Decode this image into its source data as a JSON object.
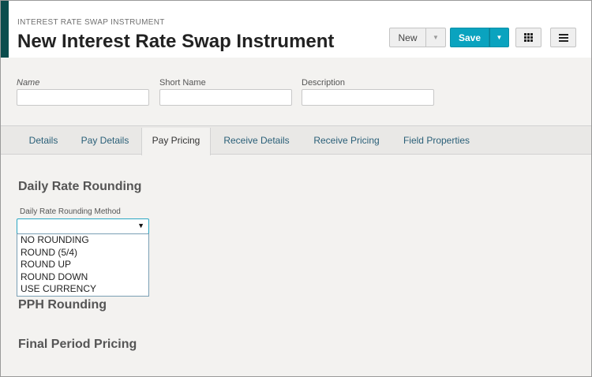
{
  "header": {
    "breadcrumb": "INTEREST RATE SWAP INSTRUMENT",
    "title": "New Interest Rate Swap Instrument",
    "new_label": "New",
    "save_label": "Save",
    "accent_color": "#0b4d4d",
    "save_color": "#0aa3bf"
  },
  "fields": {
    "name_label": "Name",
    "name_value": "",
    "short_name_label": "Short Name",
    "short_name_value": "",
    "description_label": "Description",
    "description_value": ""
  },
  "tabs": [
    {
      "label": "Details"
    },
    {
      "label": "Pay Details"
    },
    {
      "label": "Pay Pricing",
      "active": true
    },
    {
      "label": "Receive Details"
    },
    {
      "label": "Receive Pricing"
    },
    {
      "label": "Field Properties"
    }
  ],
  "content": {
    "section1": "Daily Rate Rounding",
    "rounding_method_label": "Daily Rate Rounding Method",
    "rounding_method_value": "",
    "options": [
      "NO ROUNDING",
      "ROUND (5/4)",
      "ROUND UP",
      "ROUND DOWN",
      "USE CURRENCY"
    ],
    "section2": "PPH Rounding",
    "section3": "Final Period Pricing"
  },
  "icons": {
    "grid": "grid-icon",
    "menu": "hamburger-menu-icon",
    "caret": "caret-down-icon"
  }
}
